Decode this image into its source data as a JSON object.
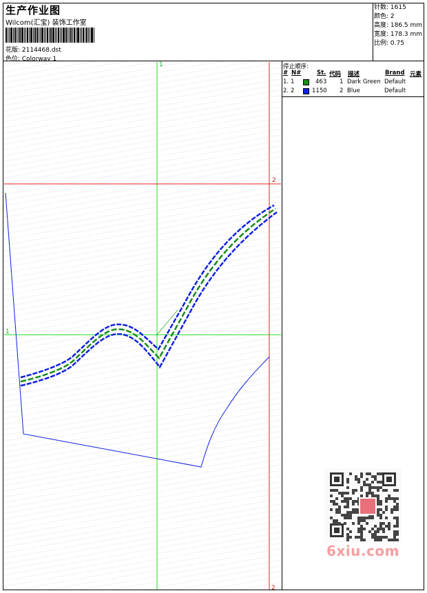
{
  "header": {
    "title": "生产作业图",
    "subtitle": "Wilcom(汇宝) 装饰工作室",
    "file_label": "花版: 2114468.dst",
    "color_label": "色位:  Colorway 1"
  },
  "stats": {
    "stitches": "针数: 1615",
    "colors": "颜色: 2",
    "height": "高度: 186.5 mm",
    "width": "宽度: 178.3 mm",
    "scale": "比例: 0.75"
  },
  "stop_sequence": {
    "title": "停止顺序:",
    "headers": {
      "num": "#",
      "no": "N#",
      "stitches": "St.",
      "code": "代码",
      "desc": "描述",
      "brand": "Brand",
      "element": "元素"
    },
    "rows": [
      {
        "num": "1.",
        "no": "1",
        "color": "#1a8a1a",
        "stitches": "463",
        "code": "1",
        "desc": "Dark Green",
        "brand": "Default"
      },
      {
        "num": "2.",
        "no": "2",
        "color": "#1020e0",
        "stitches": "1150",
        "code": "2",
        "desc": "Blue",
        "brand": "Default"
      }
    ]
  },
  "guides": {
    "v_green_label": "1",
    "h_green_label": "1",
    "h_red_label": "2",
    "v_red_label": "2"
  },
  "colors": {
    "green_guide": "#22dd22",
    "red_guide": "#ee2222",
    "thread_green": "#1a8a1a",
    "thread_blue": "#1020e0"
  },
  "watermark": {
    "text": "6xiu.com"
  }
}
